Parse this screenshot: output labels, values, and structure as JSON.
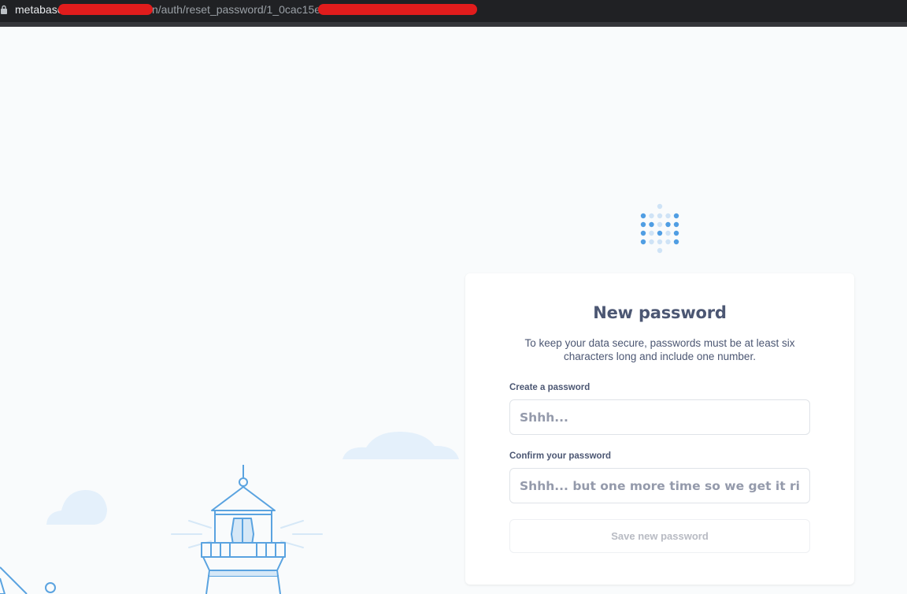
{
  "browser": {
    "url_host": "metabase",
    "url_path": "n/auth/reset_password/1_0cac15e0"
  },
  "card": {
    "title": "New password",
    "description": "To keep your data secure, passwords must be at least six characters long and include one number.",
    "password_label": "Create a password",
    "password_placeholder": "Shhh...",
    "confirm_label": "Confirm your password",
    "confirm_placeholder": "Shhh... but one more time so we get it right",
    "submit_label": "Save new password"
  },
  "colors": {
    "background": "#f9fbfc",
    "brand": "#509ee3",
    "text": "#4c5773",
    "placeholder": "#949aab",
    "disabled_text": "#b8bbc3",
    "redaction": "#e11c1c"
  },
  "icons": {
    "lock": "lock-icon",
    "logo": "metabase-logo",
    "illustration": "lighthouse-illustration"
  }
}
